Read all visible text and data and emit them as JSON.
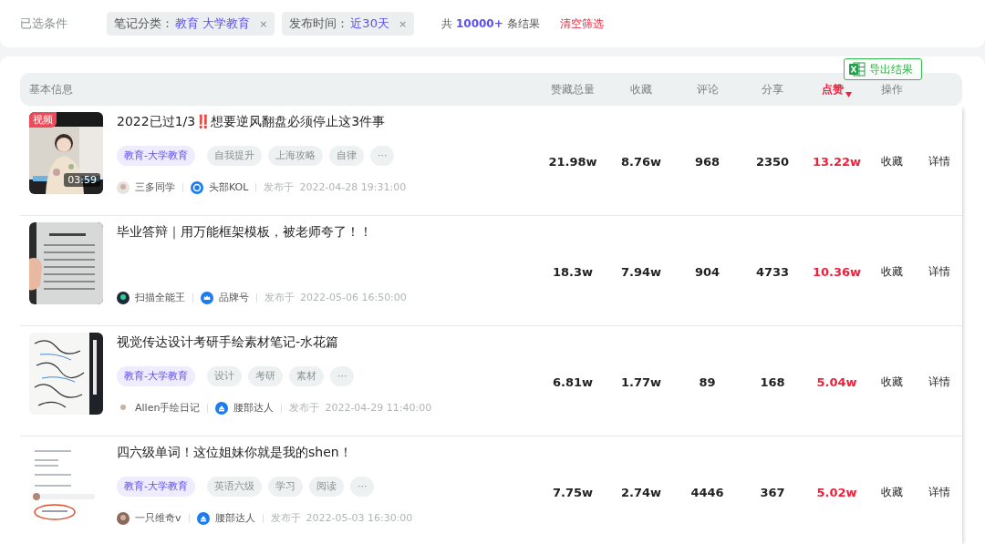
{
  "filters": {
    "label": "已选条件",
    "chips": [
      {
        "name": "笔记分类：",
        "value": "教育 大学教育",
        "remove": "×"
      },
      {
        "name": "发布时间：",
        "value": "近30天",
        "remove": "×"
      }
    ],
    "result_count": "共 **10000+** 条结果",
    "clear": "清空筛选"
  },
  "export_button": "导出结果",
  "table": {
    "columns": [
      {
        "label": "基本信息",
        "sorted": false
      },
      {
        "label": "赞藏总量",
        "sorted": false
      },
      {
        "label": "收藏",
        "sorted": false
      },
      {
        "label": "评论",
        "sorted": false
      },
      {
        "label": "分享",
        "sorted": false
      },
      {
        "label": "点赞",
        "sorted": true
      },
      {
        "label": "操作",
        "sorted": false
      }
    ],
    "rows": [
      {
        "video_badge": "视频",
        "duration": "03:59",
        "title": "2022已过1/3‼️想要逆风翻盘必须停止这3件事",
        "tags": [
          {
            "label": "教育-大学教育",
            "kind": "category"
          },
          {
            "label": "自我提升",
            "kind": "topic"
          },
          {
            "label": "上海攻略",
            "kind": "topic"
          },
          {
            "label": "自律",
            "kind": "topic"
          },
          {
            "label": "···",
            "kind": "more"
          }
        ],
        "author": "三多同学",
        "badge": {
          "kind": "kol",
          "label": "头部KOL"
        },
        "published_label": "发布于",
        "published": "2022-04-28 19:31:00",
        "stats": [
          "21.98w",
          "8.76w",
          "968",
          "2350",
          "13.22w"
        ],
        "actions": [
          "收藏",
          "详情"
        ]
      },
      {
        "title": "毕业答辩｜用万能框架模板，被老师夸了！！",
        "tags": [],
        "author": "扫描全能王",
        "badge": {
          "kind": "brand",
          "label": "品牌号"
        },
        "published_label": "发布于",
        "published": "2022-05-06 16:50:00",
        "stats": [
          "18.3w",
          "7.94w",
          "904",
          "4733",
          "10.36w"
        ],
        "actions": [
          "收藏",
          "详情"
        ]
      },
      {
        "title": "视觉传达设计考研手绘素材笔记-水花篇",
        "tags": [
          {
            "label": "教育-大学教育",
            "kind": "category"
          },
          {
            "label": "设计",
            "kind": "topic"
          },
          {
            "label": "考研",
            "kind": "topic"
          },
          {
            "label": "素材",
            "kind": "topic"
          },
          {
            "label": "···",
            "kind": "more"
          }
        ],
        "author": "Allen手绘日记",
        "badge": {
          "kind": "waist",
          "label": "腰部达人"
        },
        "published_label": "发布于",
        "published": "2022-04-29 11:40:00",
        "stats": [
          "6.81w",
          "1.77w",
          "89",
          "168",
          "5.04w"
        ],
        "actions": [
          "收藏",
          "详情"
        ]
      },
      {
        "title": "四六级单词！这位姐妹你就是我的shen！",
        "tags": [
          {
            "label": "教育-大学教育",
            "kind": "category"
          },
          {
            "label": "英语六级",
            "kind": "topic"
          },
          {
            "label": "学习",
            "kind": "topic"
          },
          {
            "label": "阅读",
            "kind": "topic"
          },
          {
            "label": "···",
            "kind": "more"
          }
        ],
        "author": "一只维奇v",
        "badge": {
          "kind": "waist",
          "label": "腰部达人"
        },
        "published_label": "发布于",
        "published": "2022-05-03 16:30:00",
        "stats": [
          "7.75w",
          "2.74w",
          "4446",
          "367",
          "5.02w"
        ],
        "actions": [
          "收藏",
          "详情"
        ]
      }
    ]
  }
}
